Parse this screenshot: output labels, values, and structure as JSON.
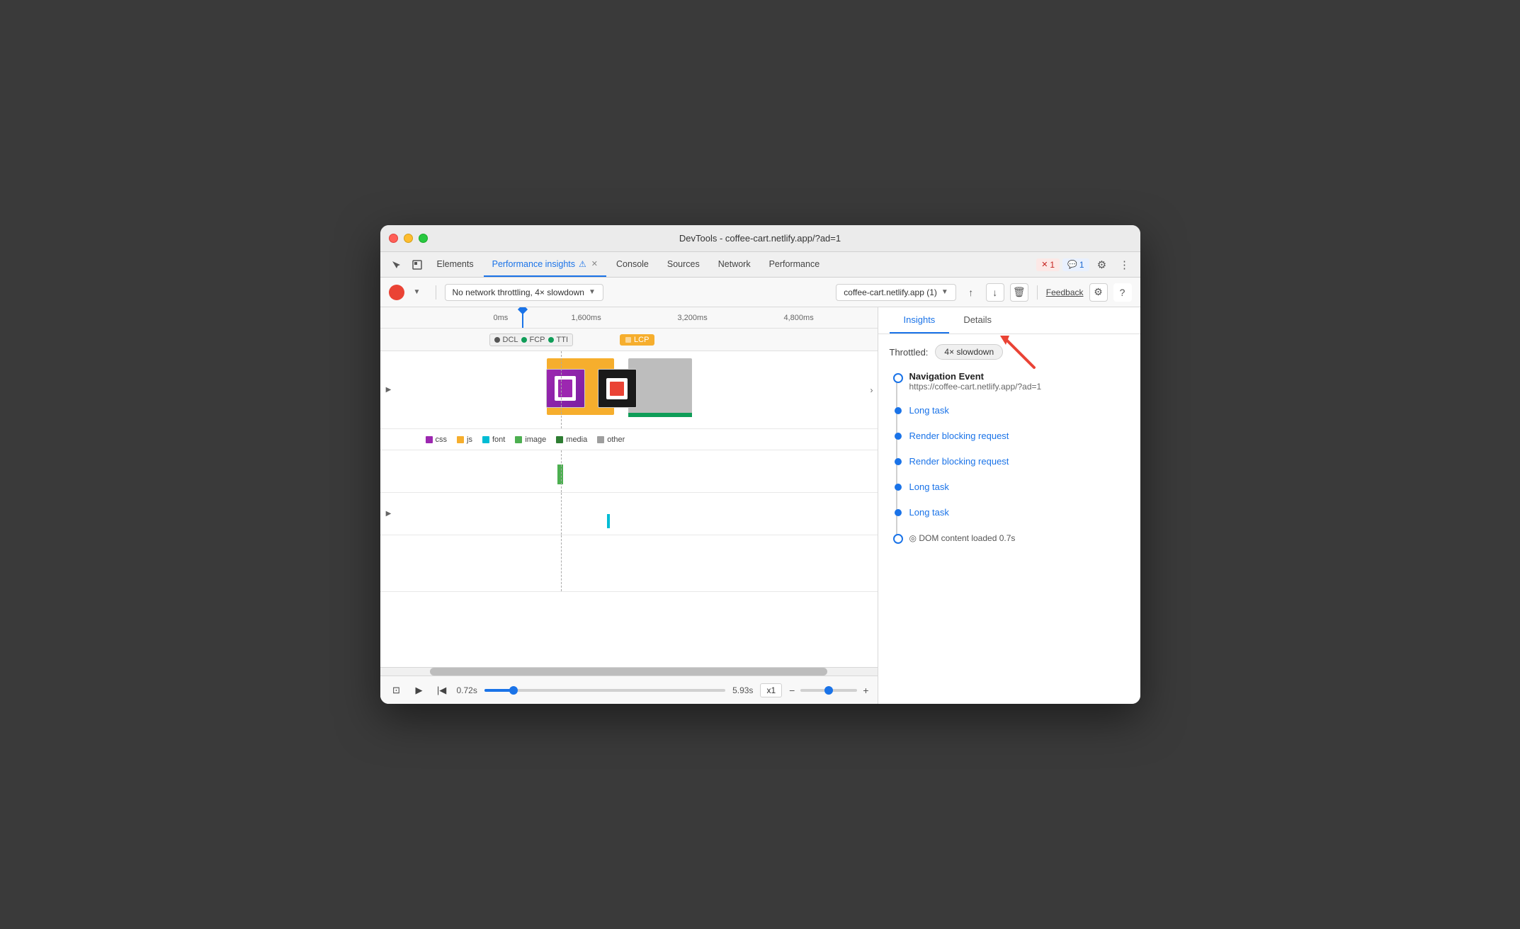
{
  "window": {
    "title": "DevTools - coffee-cart.netlify.app/?ad=1"
  },
  "tabs": {
    "items": [
      {
        "label": "Elements",
        "active": false
      },
      {
        "label": "Performance insights",
        "active": true
      },
      {
        "label": "Console",
        "active": false
      },
      {
        "label": "Sources",
        "active": false
      },
      {
        "label": "Network",
        "active": false
      },
      {
        "label": "Performance",
        "active": false
      }
    ],
    "more_label": "»",
    "error_badge": "1",
    "info_badge": "1"
  },
  "toolbar": {
    "throttle_label": "No network throttling, 4× slowdown",
    "url_label": "coffee-cart.netlify.app (1)",
    "feedback_label": "Feedback"
  },
  "timeline": {
    "markers": [
      "0ms",
      "1,600ms",
      "3,200ms",
      "4,800ms"
    ],
    "tags": [
      "DCL",
      "FCP",
      "TTI",
      "LCP"
    ],
    "legend": [
      "css",
      "js",
      "font",
      "image",
      "media",
      "other"
    ]
  },
  "playback": {
    "start_time": "0.72s",
    "end_time": "5.93s",
    "speed": "x1"
  },
  "right_panel": {
    "tabs": [
      {
        "label": "Insights",
        "active": true
      },
      {
        "label": "Details",
        "active": false
      }
    ],
    "throttled_label": "Throttled:",
    "throttled_value": "4× slowdown",
    "events": [
      {
        "type": "navigation",
        "title": "Navigation Event",
        "url": "https://coffee-cart.netlify.app/?ad=1",
        "dot": "open"
      },
      {
        "type": "link",
        "label": "Long task",
        "dot": "filled"
      },
      {
        "type": "link",
        "label": "Render blocking request",
        "dot": "filled"
      },
      {
        "type": "link",
        "label": "Render blocking request",
        "dot": "filled"
      },
      {
        "type": "link",
        "label": "Long task",
        "dot": "filled"
      },
      {
        "type": "link",
        "label": "Long task",
        "dot": "filled"
      },
      {
        "type": "dom_content",
        "label": "DOM content loaded 0.7s",
        "dot": "open"
      }
    ]
  }
}
